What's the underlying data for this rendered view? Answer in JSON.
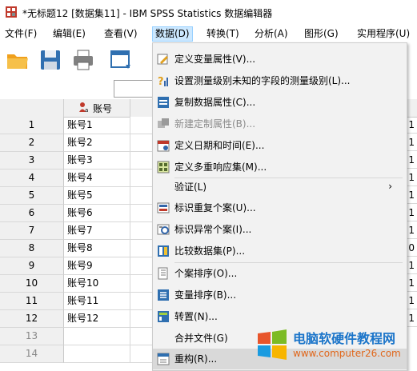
{
  "window": {
    "title": "*无标题12 [数据集11] - IBM SPSS Statistics 数据编辑器"
  },
  "menubar": [
    {
      "label": "文件(F)"
    },
    {
      "label": "编辑(E)"
    },
    {
      "label": "查看(V)"
    },
    {
      "label": "数据(D)",
      "active": true
    },
    {
      "label": "转换(T)"
    },
    {
      "label": "分析(A)"
    },
    {
      "label": "图形(G)"
    },
    {
      "label": "实用程序(U)"
    }
  ],
  "toolbar": [
    {
      "icon": "open-folder-icon"
    },
    {
      "icon": "save-icon"
    },
    {
      "icon": "print-icon"
    },
    {
      "icon": "dialog-recall-icon"
    }
  ],
  "grid": {
    "column_header": "账号",
    "rows": [
      {
        "num": "1",
        "value": "账号1",
        "right": "1"
      },
      {
        "num": "2",
        "value": "账号2",
        "right": "1"
      },
      {
        "num": "3",
        "value": "账号3",
        "right": "1"
      },
      {
        "num": "4",
        "value": "账号4",
        "right": "1"
      },
      {
        "num": "5",
        "value": "账号5",
        "right": "1"
      },
      {
        "num": "6",
        "value": "账号6",
        "right": "1"
      },
      {
        "num": "7",
        "value": "账号7",
        "right": "1"
      },
      {
        "num": "8",
        "value": "账号8",
        "right": "0"
      },
      {
        "num": "9",
        "value": "账号9",
        "right": "1"
      },
      {
        "num": "10",
        "value": "账号10",
        "right": "1"
      },
      {
        "num": "11",
        "value": "账号11",
        "right": "1"
      },
      {
        "num": "12",
        "value": "账号12",
        "right": "1"
      },
      {
        "num": "13",
        "value": "",
        "right": ""
      },
      {
        "num": "14",
        "value": "",
        "right": ""
      }
    ]
  },
  "data_menu": [
    {
      "label": "定义变量属性(V)...",
      "icon": "define-properties-icon"
    },
    {
      "label": "设置测量级别未知的字段的测量级别(L)...",
      "icon": "measurement-level-icon"
    },
    {
      "label": "复制数据属性(C)...",
      "icon": "copy-properties-icon"
    },
    {
      "label": "新建定制属性(B)...",
      "icon": "custom-attribute-icon",
      "disabled": true
    },
    {
      "label": "定义日期和时间(E)...",
      "icon": "calendar-icon"
    },
    {
      "label": "定义多重响应集(M)...",
      "icon": "multiple-response-icon"
    },
    {
      "label": "验证(L)",
      "submenu": true
    },
    {
      "label": "标识重复个案(U)...",
      "icon": "duplicate-cases-icon"
    },
    {
      "label": "标识异常个案(I)...",
      "icon": "unusual-cases-icon"
    },
    {
      "label": "比较数据集(P)...",
      "icon": "compare-datasets-icon"
    },
    {
      "label": "个案排序(O)...",
      "icon": "sort-cases-icon"
    },
    {
      "label": "变量排序(B)...",
      "icon": "sort-variables-icon"
    },
    {
      "label": "转置(N)...",
      "icon": "transpose-icon"
    },
    {
      "label": "合并文件(G)"
    },
    {
      "label": "重构(R)...",
      "icon": "restructure-icon",
      "highlighted": true
    }
  ],
  "submenu_arrow": "›",
  "watermark": {
    "title": "电脑软硬件教程网",
    "url": "www.computer26.com"
  }
}
